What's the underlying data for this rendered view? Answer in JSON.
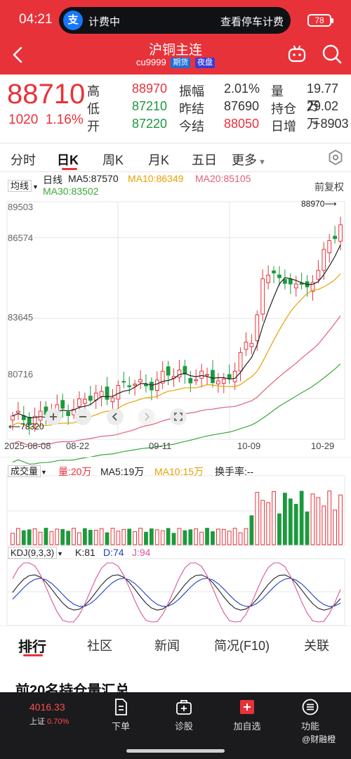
{
  "status_bar": {
    "time": "04:21",
    "pill_logo": "支",
    "pill_left": "计费中",
    "pill_right": "查看停车计费",
    "battery": "78"
  },
  "header": {
    "title": "沪铜主连",
    "code": "cu9999",
    "tag_futures": "期货",
    "tag_night": "夜盘",
    "icons": [
      "back-icon",
      "robot-icon",
      "search-icon"
    ]
  },
  "quote": {
    "price": "88710",
    "change": "1020",
    "change_pct": "1.16%",
    "rows": [
      {
        "l1": "高",
        "v1": "88970",
        "l2": "振幅",
        "v2": "2.01%",
        "l3": "量",
        "v3": "19.77万"
      },
      {
        "l1": "低",
        "v1": "87210",
        "l2": "昨结",
        "v2": "87690",
        "l3": "持仓",
        "v3": "29.02万"
      },
      {
        "l1": "开",
        "v1": "87220",
        "l2": "今结",
        "v2": "88050",
        "l3": "日增",
        "v3": "+8903"
      }
    ]
  },
  "colors": {
    "up": "#e8323a",
    "down": "#1a9a3c",
    "brand": "#e8323a"
  },
  "period_tabs": [
    "分时",
    "日K",
    "周K",
    "月K",
    "五日",
    "更多"
  ],
  "kline": {
    "mode_label": "均线",
    "series_label": "日线",
    "ma5": "MA5:87570",
    "ma10": "MA10:86349",
    "ma20": "MA20:85105",
    "ma30": "MA30:83502",
    "adjust_label": "前复权",
    "y_ticks": [
      "89503",
      "86574",
      "83645",
      "80716"
    ],
    "x_ticks": [
      "2025-08-08",
      "08-22",
      "09-11",
      "10-09",
      "10-29"
    ],
    "high_marker": "88970",
    "low_marker": "78320"
  },
  "volume": {
    "selector": "成交量",
    "vol": "量:20万",
    "ma5": "MA5:19万",
    "ma10": "MA10:15万",
    "turnover": "换手率:--"
  },
  "kdj": {
    "selector": "KDJ(9,3,3)",
    "k": "K:81",
    "d": "D:74",
    "j": "J:94"
  },
  "chart_data": {
    "type": "candlestick",
    "x": [
      "2025-08-08",
      "2025-08-22",
      "2025-09-11",
      "2025-10-09",
      "2025-10-29"
    ],
    "ylim": [
      78320,
      89503
    ],
    "y_ticks": [
      89503,
      86574,
      83645,
      80716
    ],
    "last": {
      "open": 87220,
      "high": 88970,
      "low": 87210,
      "close": 88710
    },
    "ma": {
      "MA5": 87570,
      "MA10": 86349,
      "MA20": 85105,
      "MA30": 83502
    },
    "volume_last_wan": 20,
    "kdj_last": {
      "K": 81,
      "D": 74,
      "J": 94
    }
  },
  "info_tabs": [
    "排行",
    "社区",
    "新闻",
    "简况(F10)",
    "关联"
  ],
  "section_title": "前20名持仓量汇总",
  "bottom_bar": {
    "index_value": "4016.33",
    "index_name": "上证",
    "index_pct": "0.70%",
    "items": [
      "下单",
      "诊股",
      "加自选",
      "功能"
    ]
  },
  "watermark": "@财融橙"
}
